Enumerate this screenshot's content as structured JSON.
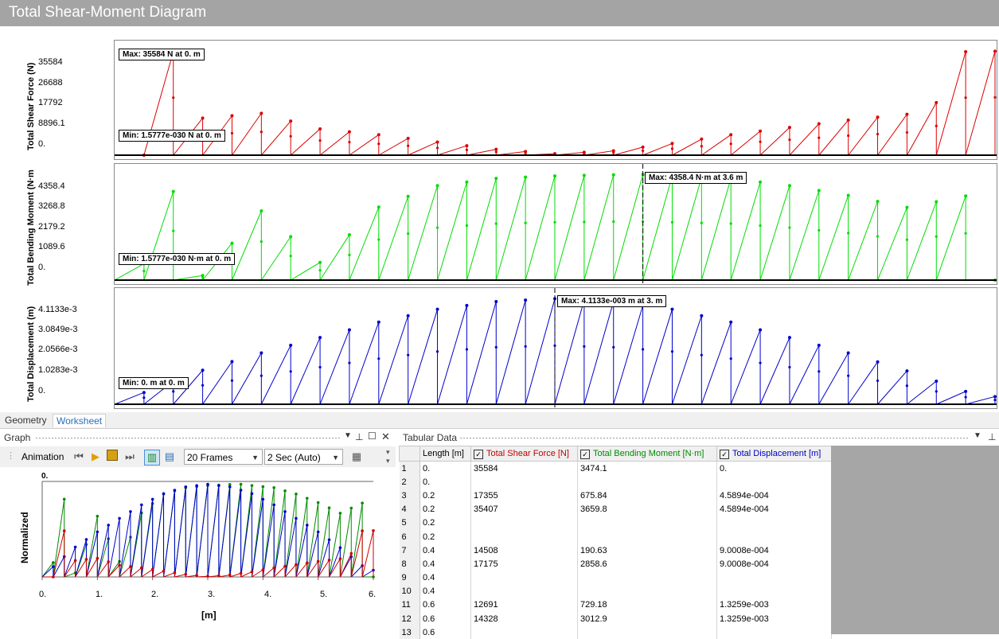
{
  "title": "Total Shear-Moment Diagram",
  "colors": {
    "shear": "#dd0000",
    "moment": "#00dd00",
    "displacement": "#0000cc"
  },
  "plots": [
    {
      "name": "shear",
      "ylabel": "Total Shear Force (N)",
      "ticks": [
        "35584",
        "26688",
        "17792",
        "8896.1",
        "0."
      ],
      "max_label": "Max: 35584 N at 0. m",
      "min_label": "Min: 1.5777e-030 N at 0. m"
    },
    {
      "name": "moment",
      "ylabel": "Total Bending Moment (N·m",
      "ticks": [
        "4358.4",
        "3268.8",
        "2179.2",
        "1089.6",
        "0."
      ],
      "max_label": "Max: 4358.4 N·m at 3.6 m",
      "min_label": "Min: 1.5777e-030 N·m at 0. m"
    },
    {
      "name": "displacement",
      "ylabel": "Total Displacement (m)",
      "ticks": [
        "4.1133e-3",
        "3.0849e-3",
        "2.0566e-3",
        "1.0283e-3",
        "0."
      ],
      "max_label": "Max: 4.1133e-003 m at 3. m",
      "min_label": "Min: 0. m at 0. m"
    }
  ],
  "chart_data": [
    {
      "type": "line",
      "ylabel": "Total Shear Force (N)",
      "xlim": [
        0,
        6
      ],
      "ylim": [
        0,
        35584
      ],
      "series": [
        {
          "name": "Total Shear Force [N]",
          "x": [
            0,
            0.2,
            0.2,
            0.4,
            0.4,
            0.6,
            0.6,
            1.0,
            1.4,
            1.8,
            2.2,
            2.6,
            3.0,
            3.4,
            3.8,
            4.2,
            4.6,
            5.0,
            5.4,
            5.6,
            5.8,
            5.8,
            6.0
          ],
          "y": [
            35584,
            0,
            17355,
            35407,
            14508,
            17175,
            12691,
            14328,
            9000,
            7000,
            4500,
            2000,
            500,
            1500,
            4000,
            7000,
            9500,
            12000,
            14000,
            18000,
            17355,
            35407,
            35584
          ]
        }
      ]
    },
    {
      "type": "line",
      "ylabel": "Total Bending Moment (N·m",
      "xlim": [
        0,
        6
      ],
      "ylim": [
        0,
        4358.4
      ],
      "series": [
        {
          "name": "Total Bending Moment [N·m]",
          "x": [
            0,
            0.2,
            0.4,
            0.6,
            1.0,
            1.4,
            1.8,
            2.2,
            2.6,
            3.0,
            3.4,
            3.6,
            3.8,
            4.2,
            4.6,
            5.0,
            5.4,
            5.8,
            6.0
          ],
          "y": [
            3474.1,
            675.84,
            3659.8,
            190.63,
            2858.6,
            729.18,
            3012.9,
            3900,
            4200,
            4300,
            4350,
            4358.4,
            4300,
            4200,
            3900,
            3500,
            3000,
            3474.1,
            0
          ]
        }
      ]
    },
    {
      "type": "line",
      "ylabel": "Total Displacement (m)",
      "xlim": [
        0,
        6
      ],
      "ylim": [
        0,
        0.0041133
      ],
      "series": [
        {
          "name": "Total Displacement [m]",
          "x": [
            0,
            0.2,
            0.4,
            0.6,
            1.0,
            1.4,
            1.8,
            2.2,
            2.6,
            3.0,
            3.4,
            3.8,
            4.2,
            4.6,
            5.0,
            5.4,
            5.8,
            6.0
          ],
          "y": [
            0,
            0.00045894,
            0.00090008,
            0.0013259,
            0.002,
            0.0026,
            0.0032,
            0.0037,
            0.004,
            0.0041133,
            0.004,
            0.0037,
            0.0032,
            0.0026,
            0.002,
            0.0013,
            0.0005,
            0.0003
          ]
        }
      ]
    }
  ],
  "tabs": {
    "geometry": "Geometry",
    "worksheet": "Worksheet"
  },
  "graph_panel": {
    "title": "Graph",
    "animation_label": "Animation",
    "frames_value": "20 Frames",
    "duration_value": "2 Sec (Auto)",
    "normalized_label": "Normalized",
    "top_tick": "0.",
    "x_ticks": [
      "0.",
      "1.",
      "2.",
      "3.",
      "4.",
      "5.",
      "6."
    ],
    "x_label": "[m]"
  },
  "tabular": {
    "title": "Tabular Data",
    "headers": [
      "Length [m]",
      "Total Shear Force [N]",
      "Total Bending Moment [N·m]",
      "Total Displacement [m]"
    ],
    "rows": [
      [
        "1",
        "0.",
        "35584",
        "3474.1",
        "0."
      ],
      [
        "2",
        "0.",
        "",
        "",
        ""
      ],
      [
        "3",
        "0.2",
        "17355",
        "675.84",
        "4.5894e-004"
      ],
      [
        "4",
        "0.2",
        "35407",
        "3659.8",
        "4.5894e-004"
      ],
      [
        "5",
        "0.2",
        "",
        "",
        ""
      ],
      [
        "6",
        "0.2",
        "",
        "",
        ""
      ],
      [
        "7",
        "0.4",
        "14508",
        "190.63",
        "9.0008e-004"
      ],
      [
        "8",
        "0.4",
        "17175",
        "2858.6",
        "9.0008e-004"
      ],
      [
        "9",
        "0.4",
        "",
        "",
        ""
      ],
      [
        "10",
        "0.4",
        "",
        "",
        ""
      ],
      [
        "11",
        "0.6",
        "12691",
        "729.18",
        "1.3259e-003"
      ],
      [
        "12",
        "0.6",
        "14328",
        "3012.9",
        "1.3259e-003"
      ],
      [
        "13",
        "0.6",
        "",
        "",
        ""
      ]
    ]
  }
}
